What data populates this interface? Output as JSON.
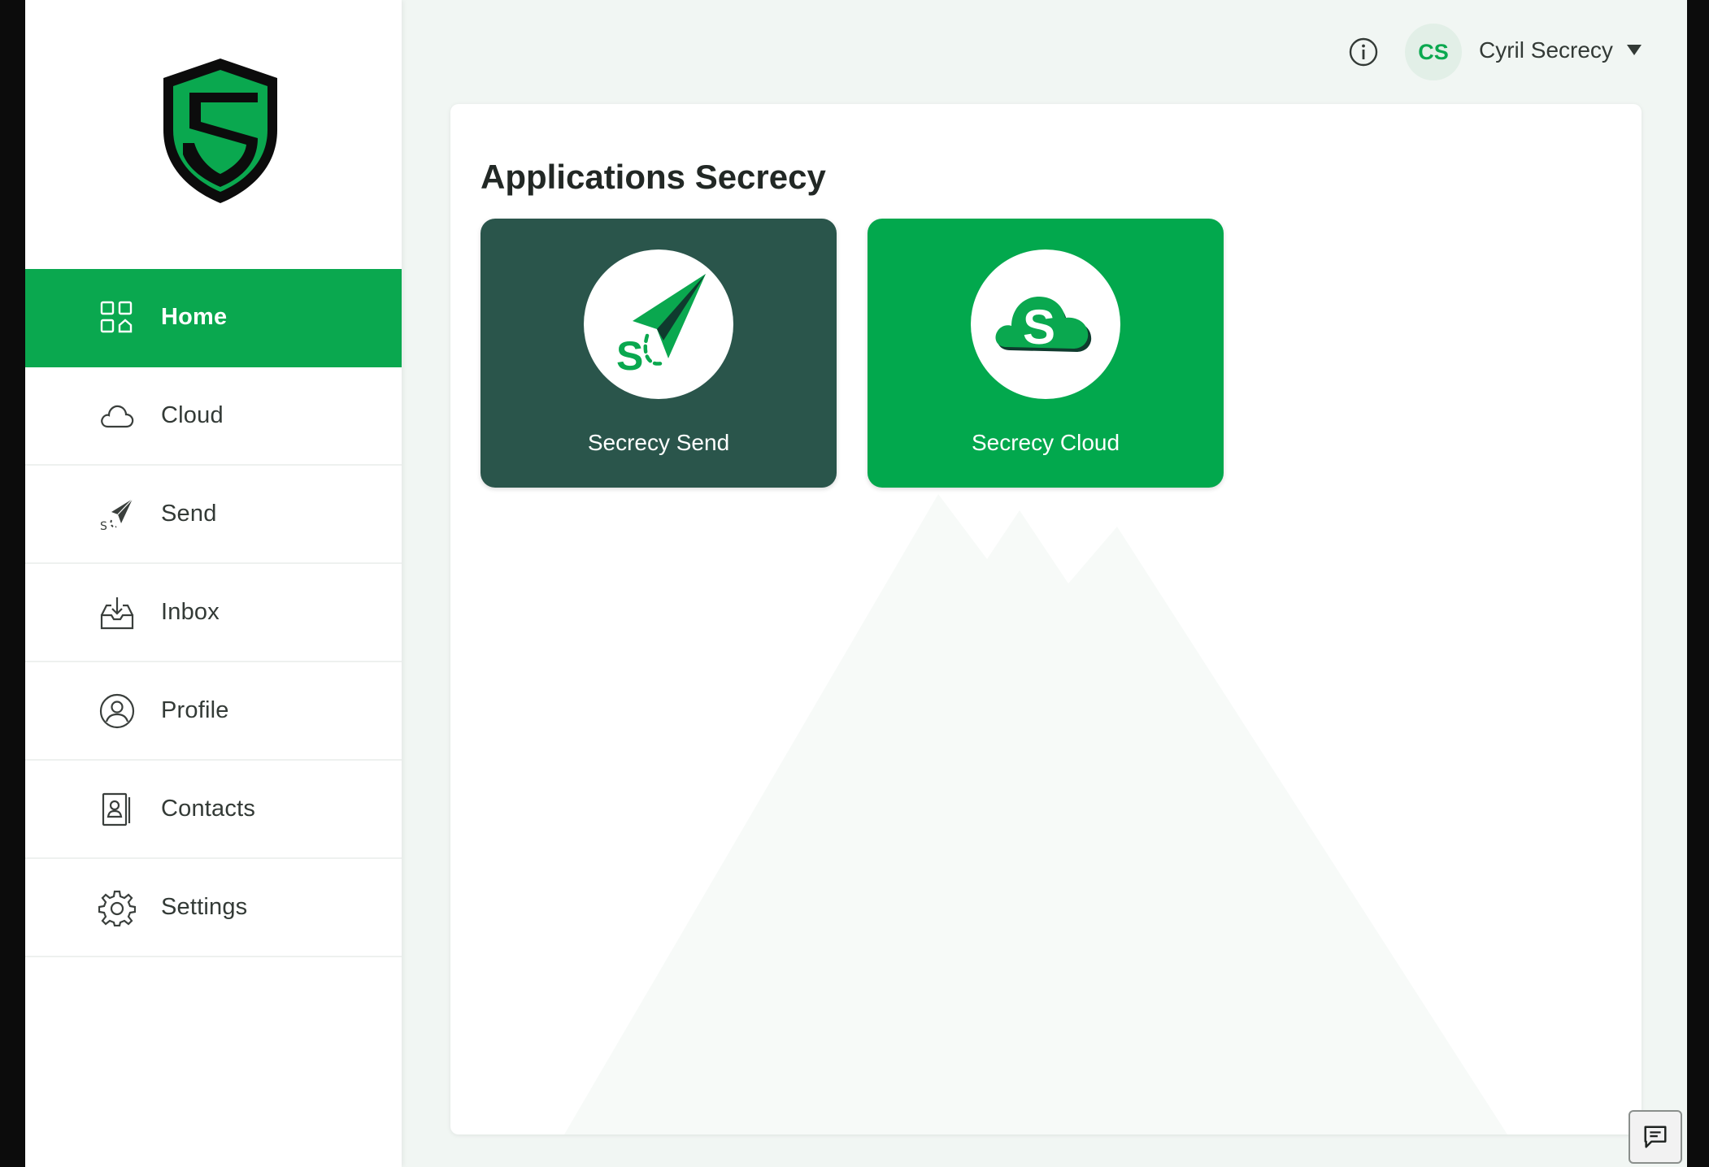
{
  "sidebar": {
    "logo": "secrecy-shield-logo",
    "items": [
      {
        "label": "Home",
        "icon": "home-grid-icon",
        "active": true
      },
      {
        "label": "Cloud",
        "icon": "cloud-icon",
        "active": false
      },
      {
        "label": "Send",
        "icon": "paper-plane-icon",
        "active": false
      },
      {
        "label": "Inbox",
        "icon": "inbox-icon",
        "active": false
      },
      {
        "label": "Profile",
        "icon": "user-circle-icon",
        "active": false
      },
      {
        "label": "Contacts",
        "icon": "contacts-book-icon",
        "active": false
      },
      {
        "label": "Settings",
        "icon": "gear-icon",
        "active": false
      }
    ]
  },
  "header": {
    "info_icon": "info-icon",
    "avatar_initials": "CS",
    "user_name": "Cyril Secrecy",
    "menu_icon": "caret-down-icon"
  },
  "main": {
    "title": "Applications Secrecy",
    "apps": [
      {
        "label": "Secrecy Send",
        "icon": "paper-plane-icon",
        "color": "#2a554b"
      },
      {
        "label": "Secrecy Cloud",
        "icon": "cloud-s-icon",
        "color": "#02a84d"
      }
    ]
  },
  "chat_icon": "chat-icon",
  "colors": {
    "brand_green": "#0aa84f",
    "dark_green": "#2a554b",
    "page_bg": "#f1f6f3"
  }
}
